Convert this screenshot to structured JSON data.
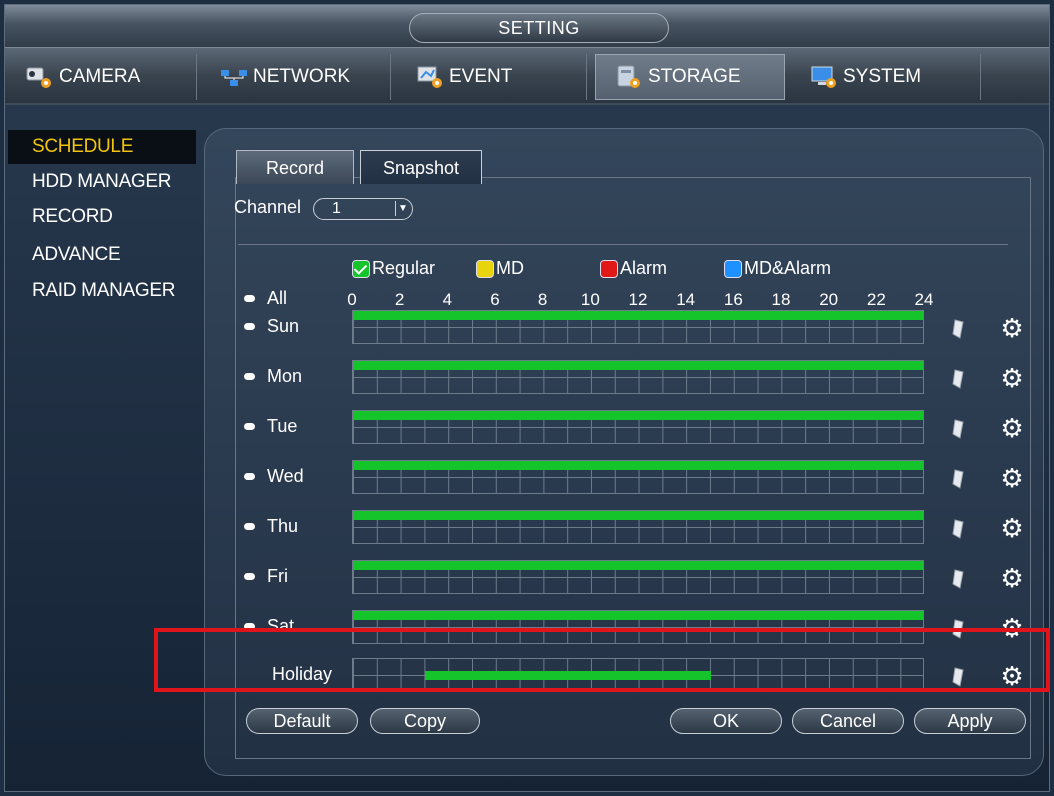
{
  "window": {
    "title": "SETTING"
  },
  "nav": [
    {
      "label": "CAMERA"
    },
    {
      "label": "NETWORK"
    },
    {
      "label": "EVENT"
    },
    {
      "label": "STORAGE"
    },
    {
      "label": "SYSTEM"
    }
  ],
  "sidebar": {
    "items": [
      {
        "label": "SCHEDULE"
      },
      {
        "label": "HDD MANAGER"
      },
      {
        "label": "RECORD"
      },
      {
        "label": "ADVANCE"
      },
      {
        "label": "RAID MANAGER"
      }
    ]
  },
  "tabs": [
    {
      "label": "Record"
    },
    {
      "label": "Snapshot"
    }
  ],
  "channel": {
    "label": "Channel",
    "value": "1"
  },
  "legend": [
    {
      "label": "Regular",
      "color": "#14c42a"
    },
    {
      "label": "MD",
      "color": "#e8d40c"
    },
    {
      "label": "Alarm",
      "color": "#e01818"
    },
    {
      "label": "MD&Alarm",
      "color": "#1e90ff"
    }
  ],
  "all_label": "All",
  "hours": [
    "0",
    "2",
    "4",
    "6",
    "8",
    "10",
    "12",
    "14",
    "16",
    "18",
    "20",
    "22",
    "24"
  ],
  "days": [
    {
      "label": "Sun",
      "start": 0,
      "end": 24
    },
    {
      "label": "Mon",
      "start": 0,
      "end": 24
    },
    {
      "label": "Tue",
      "start": 0,
      "end": 24
    },
    {
      "label": "Wed",
      "start": 0,
      "end": 24
    },
    {
      "label": "Thu",
      "start": 0,
      "end": 24
    },
    {
      "label": "Fri",
      "start": 0,
      "end": 24
    },
    {
      "label": "Sat",
      "start": 0,
      "end": 24
    },
    {
      "label": "Holiday",
      "start": 3,
      "end": 15
    }
  ],
  "buttons": {
    "default": "Default",
    "copy": "Copy",
    "ok": "OK",
    "cancel": "Cancel",
    "apply": "Apply"
  }
}
